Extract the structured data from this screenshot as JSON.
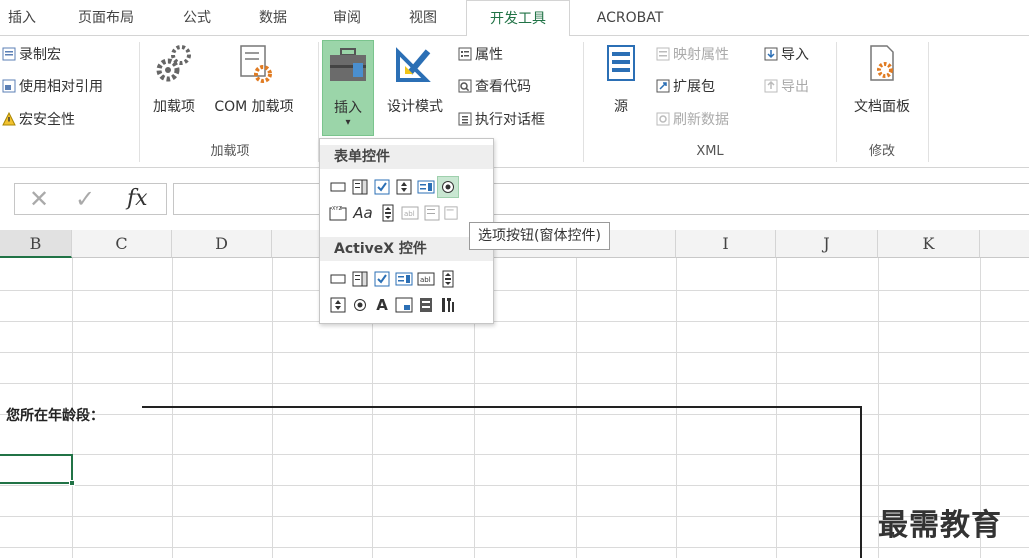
{
  "tabs": [
    "插入",
    "页面布局",
    "公式",
    "数据",
    "审阅",
    "视图",
    "开发工具",
    "ACROBAT"
  ],
  "active_tab": "开发工具",
  "ribbon": {
    "code": {
      "record_macro": "录制宏",
      "relative_ref": "使用相对引用",
      "macro_security": "宏安全性"
    },
    "addins": {
      "addins": "加载项",
      "com_addins": "COM 加载项",
      "group_label": "加载项"
    },
    "controls": {
      "insert": "插入",
      "design_mode": "设计模式",
      "properties": "属性",
      "view_code": "查看代码",
      "run_dialog": "执行对话框"
    },
    "xml": {
      "source": "源",
      "map_properties": "映射属性",
      "expansion_packs": "扩展包",
      "refresh_data": "刷新数据",
      "import": "导入",
      "export": "导出",
      "group_label": "XML"
    },
    "modify": {
      "doc_panel": "文档面板",
      "group_label": "修改"
    }
  },
  "formula_bar": {
    "fx": "fx"
  },
  "columns": [
    "B",
    "C",
    "D",
    "I",
    "J",
    "K"
  ],
  "dropdown": {
    "form_controls_header": "表单控件",
    "activex_header": "ActiveX 控件",
    "tooltip": "选项按钮(窗体控件)"
  },
  "sheet": {
    "label": "您所在年龄段："
  },
  "watermark": "最需教育",
  "colors": {
    "accent": "#217346",
    "selected_button": "#9bd5a9"
  }
}
